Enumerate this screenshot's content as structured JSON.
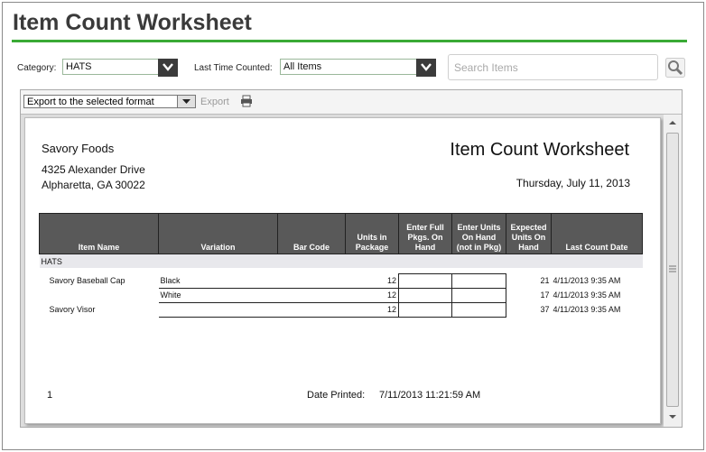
{
  "page_title": "Item Count Worksheet",
  "filters": {
    "category_label": "Category:",
    "category_value": "HATS",
    "last_counted_label": "Last Time Counted:",
    "last_counted_value": "All Items",
    "search_placeholder": "Search Items"
  },
  "toolbar": {
    "export_format_value": "Export to the selected format",
    "export_label": "Export"
  },
  "report": {
    "company": "Savory Foods",
    "address1": "4325 Alexander Drive",
    "address2": "Alpharetta, GA 30022",
    "title": "Item Count Worksheet",
    "date": "Thursday, July 11, 2013",
    "columns": [
      "Item Name",
      "Variation",
      "Bar Code",
      "Units in Package",
      "Enter Full Pkgs. On Hand",
      "Enter Units On Hand (not in Pkg)",
      "Expected Units On Hand",
      "Last Count Date"
    ],
    "group": "HATS",
    "rows": [
      {
        "item": "Savory Baseball Cap",
        "variation": "Black",
        "barcode": "",
        "units": "12",
        "expected": "21",
        "last": "4/11/2013 9:35 AM"
      },
      {
        "item": "",
        "variation": "White",
        "barcode": "",
        "units": "12",
        "expected": "17",
        "last": "4/11/2013 9:35 AM"
      },
      {
        "item": "Savory Visor",
        "variation": "",
        "barcode": "",
        "units": "12",
        "expected": "37",
        "last": "4/11/2013 9:35 AM"
      }
    ],
    "page_number": "1",
    "printed_label": "Date Printed:",
    "printed_value": "7/11/2013 11:21:59 AM"
  },
  "colors": {
    "accent": "#3aaa35",
    "header_bg": "#595959"
  }
}
